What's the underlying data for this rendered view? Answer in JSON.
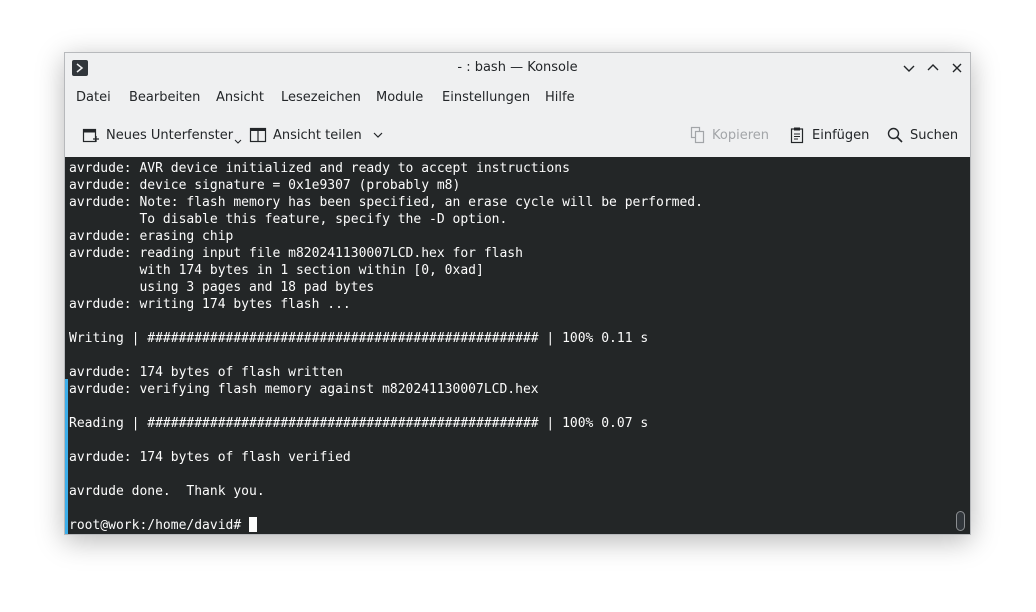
{
  "window": {
    "title": "- : bash — Konsole"
  },
  "menubar": {
    "items": [
      "Datei",
      "Bearbeiten",
      "Ansicht",
      "Lesezeichen",
      "Module",
      "Einstellungen",
      "Hilfe"
    ]
  },
  "toolbar": {
    "new_tab": "Neues Unterfenster",
    "split_view": "Ansicht teilen",
    "copy": "Kopieren",
    "paste": "Einfügen",
    "search": "Suchen"
  },
  "terminal": {
    "lines": [
      "avrdude: AVR device initialized and ready to accept instructions",
      "avrdude: device signature = 0x1e9307 (probably m8)",
      "avrdude: Note: flash memory has been specified, an erase cycle will be performed.",
      "         To disable this feature, specify the -D option.",
      "avrdude: erasing chip",
      "avrdude: reading input file m820241130007LCD.hex for flash",
      "         with 174 bytes in 1 section within [0, 0xad]",
      "         using 3 pages and 18 pad bytes",
      "avrdude: writing 174 bytes flash ...",
      "",
      "Writing | ################################################## | 100% 0.11 s",
      "",
      "avrdude: 174 bytes of flash written",
      "avrdude: verifying flash memory against m820241130007LCD.hex",
      "",
      "Reading | ################################################## | 100% 0.07 s",
      "",
      "avrdude: 174 bytes of flash verified",
      "",
      "avrdude done.  Thank you.",
      ""
    ],
    "prompt": "root@work:/home/david# "
  },
  "colors": {
    "terminal_bg": "#232627",
    "terminal_fg": "#fcfcfc",
    "accent": "#3daee9",
    "window_bg": "#eff0f1"
  },
  "icons": {
    "app": "konsole-icon",
    "minimize": "chevron-down-icon",
    "maximize": "chevron-up-icon",
    "close": "close-icon",
    "new_tab": "new-tab-icon",
    "split": "split-view-icon",
    "copy": "copy-icon",
    "paste": "paste-icon",
    "search": "search-icon"
  }
}
